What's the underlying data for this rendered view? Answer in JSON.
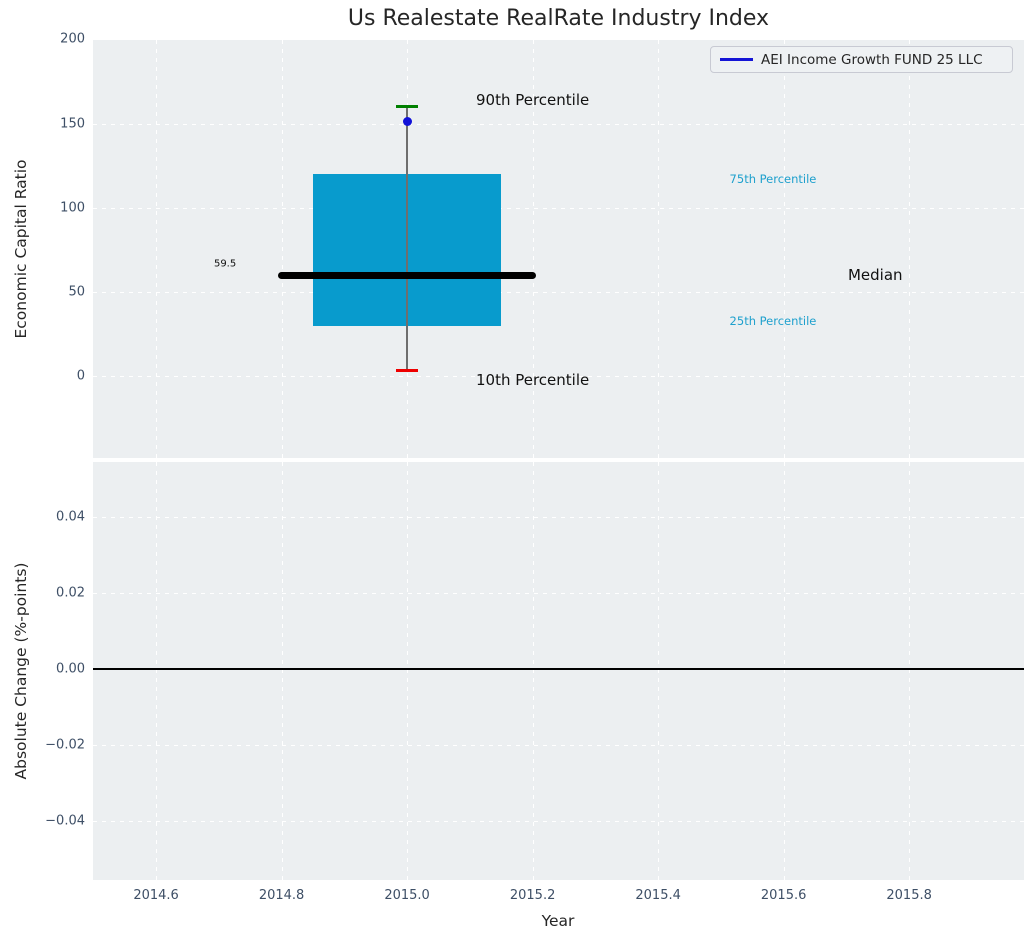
{
  "title": "Us Realestate RealRate Industry Index",
  "legend": {
    "label": "AEI Income Growth FUND 25 LLC",
    "line_color": "#1414d6",
    "position": "upper right"
  },
  "colors": {
    "axes_bg": "#eceff1",
    "grid": "#ffffff",
    "box_fill": "#089bcd",
    "median": "#000000",
    "whisker": "#6e6e6e",
    "cap_top": "#008000",
    "cap_bottom": "#ee0000",
    "fund_dot": "#1111d8",
    "tick_label": "#3e4f66",
    "percentile_label": "#1ea0cd",
    "text": "#111111",
    "zero_line": "#000000"
  },
  "chart_data": [
    {
      "type": "box",
      "title": "Us Realestate RealRate Industry Index",
      "ylabel": "Economic Capital Ratio",
      "xlim": [
        2014.4995,
        2015.983
      ],
      "ylim": [
        -48.6,
        199.6
      ],
      "yticks": [
        200,
        150,
        100,
        50,
        0
      ],
      "ytick_labels": [
        "200",
        "150",
        "100",
        "50",
        "0"
      ],
      "xticks": [
        2014.6,
        2014.8,
        2015.0,
        2015.2,
        2015.4,
        2015.6,
        2015.8
      ],
      "grid": true,
      "box": {
        "x": 2015.0,
        "half_width": 0.15,
        "median_half_width": 0.205,
        "cap_half_width": 0.018,
        "p10": 3.5,
        "p25": 29.5,
        "median": 59.5,
        "p75": 120,
        "p90": 160,
        "median_label": "59.5"
      },
      "series": [
        {
          "name": "AEI Income Growth FUND 25 LLC",
          "x": 2015.0,
          "y": 151.5
        }
      ],
      "annotations": [
        {
          "text": "90th Percentile",
          "x": 2015.2,
          "y": 164,
          "color": "#111111",
          "size": "lg"
        },
        {
          "text": "10th Percentile",
          "x": 2015.2,
          "y": -2,
          "color": "#111111",
          "size": "lg"
        },
        {
          "text": "59.5",
          "x": 2014.71,
          "y": 66.5,
          "color": "#111111",
          "size": "sm"
        },
        {
          "text": "75th Percentile",
          "x": 2015.583,
          "y": 117,
          "color": "#1ea0cd",
          "size": "md"
        },
        {
          "text": "Median",
          "x": 2015.746,
          "y": 60,
          "color": "#111111",
          "size": "lg"
        },
        {
          "text": "25th Percentile",
          "x": 2015.583,
          "y": 33,
          "color": "#1ea0cd",
          "size": "md"
        }
      ]
    },
    {
      "type": "line",
      "ylabel": "Absolute Change (%-points)",
      "xlabel": "Year",
      "xlim": [
        2014.4995,
        2015.983
      ],
      "ylim": [
        -0.0555,
        0.0545
      ],
      "yticks": [
        0.04,
        0.02,
        0.0,
        -0.02,
        -0.04
      ],
      "ytick_labels": [
        "0.04",
        "0.02",
        "0.00",
        "−0.02",
        "−0.04"
      ],
      "xticks": [
        2014.6,
        2014.8,
        2015.0,
        2015.2,
        2015.4,
        2015.6,
        2015.8
      ],
      "xtick_labels": [
        "2014.6",
        "2014.8",
        "2015.0",
        "2015.2",
        "2015.4",
        "2015.6",
        "2015.8"
      ],
      "grid": true,
      "zero_line": 0.0,
      "series": []
    }
  ]
}
